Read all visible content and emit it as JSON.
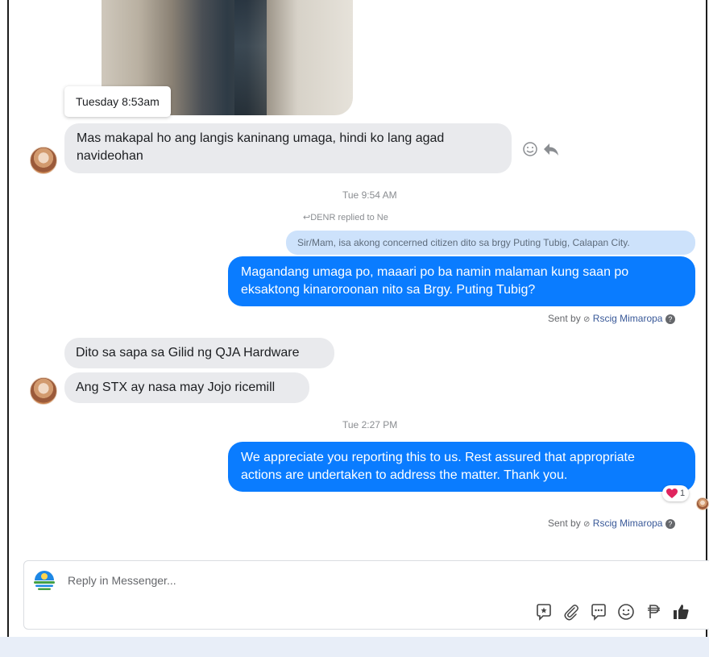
{
  "tooltip": {
    "text": "Tuesday 8:53am"
  },
  "messages": {
    "incoming_1": {
      "lines": [
        "Mas makapal ho ang langis kaninang umaga, hindi ko lang agad",
        "navideohan"
      ]
    },
    "timestamp_1": "Tue 9:54 AM",
    "reply_note": "DENR replied to Ne",
    "quoted_text": "Sir/Mam, isa akong concerned citizen dito sa brgy Puting Tubig, Calapan City.",
    "outgoing_1": {
      "lines": [
        "Magandang umaga po, maaari po ba namin malaman kung saan po",
        "eksaktong kinaroroonan nito sa Brgy. Puting Tubig?"
      ]
    },
    "sent_by_1": {
      "prefix": "Sent by",
      "name": "Rscig Mimaropa"
    },
    "incoming_2": "Dito sa sapa sa Gilid ng QJA Hardware",
    "incoming_3": "Ang STX ay nasa may Jojo ricemill",
    "timestamp_2": "Tue 2:27 PM",
    "outgoing_2": {
      "lines": [
        "We appreciate you reporting this to us. Rest assured that appropriate",
        "actions are undertaken to address the matter. Thank you."
      ]
    },
    "reaction": {
      "emoji": "heart",
      "count": "1"
    },
    "sent_by_2": {
      "prefix": "Sent by",
      "name": "Rscig Mimaropa"
    }
  },
  "composer": {
    "placeholder": "Reply in Messenger...",
    "tools": [
      "sticker-icon",
      "attachment-icon",
      "saved-reply-icon",
      "emoji-icon",
      "peso-icon",
      "thumbs-up-icon"
    ]
  },
  "colors": {
    "outgoing": "#0a7cff",
    "incoming": "#e9eaed",
    "quote": "#cde2fb",
    "link": "#385898",
    "heart": "#e0245e"
  }
}
